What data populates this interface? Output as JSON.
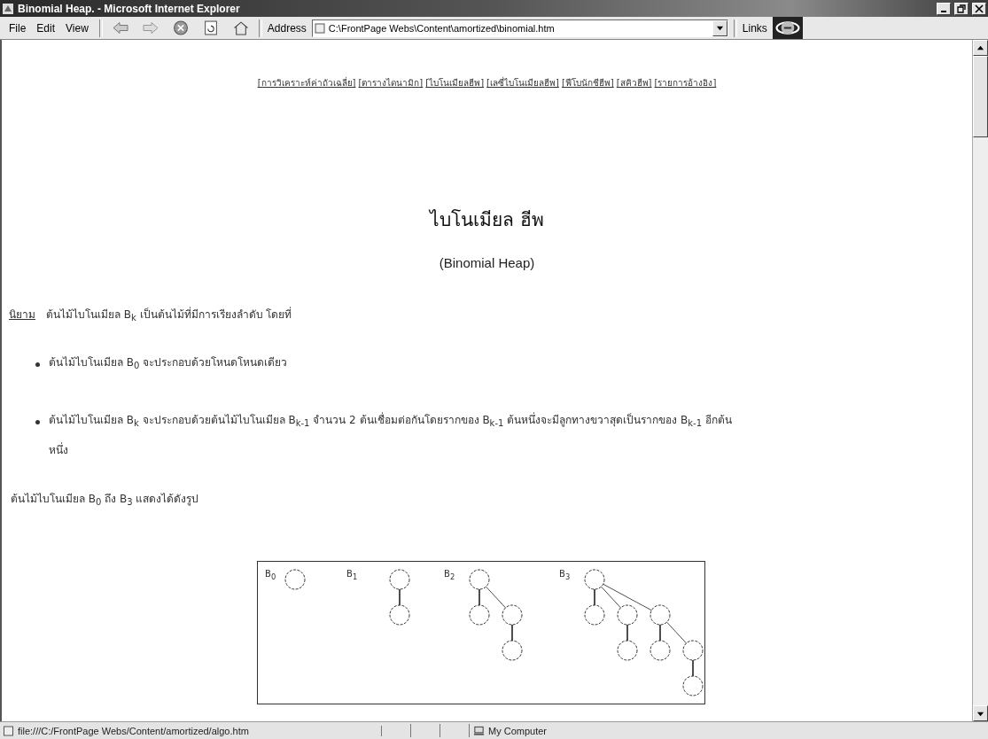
{
  "window": {
    "title": "Binomial Heap. - Microsoft Internet Explorer"
  },
  "menu": [
    "File",
    "Edit",
    "View"
  ],
  "address": {
    "label": "Address",
    "value": "C:\\FrontPage Webs\\Content\\amortized\\binomial.htm"
  },
  "links_label": "Links",
  "nav_links": [
    "[การวิเคราะห์ค่าถัวเฉลี่ย]",
    "[ตารางไดนามิก]",
    "[ไบโนเมียลฮีพ]",
    "[เลซี่ไบโนเมียลฮีพ]",
    "[ฟีโบนักชีฮีพ]",
    "[สคิวฮีพ]",
    "[รายการอ้างอิง]"
  ],
  "heading": "ไบโนเมียล ฮีพ",
  "subheading": "(Binomial Heap)",
  "definition": {
    "term": "นิยาม",
    "text": "ต้นไม้ไบโนเมียล B$_{k}$ เป็นต้นไม้ที่มีการเรียงลำดับ โดยที่"
  },
  "bullets": [
    "ต้นไม้ไบโนเมียล B$_{0}$ จะประกอบด้วยโหนดโหนดเดียว",
    "ต้นไม้ไบโนเมียล B$_{k}$ จะประกอบด้วยต้นไม้ไบโนเมียล B$_{k-1}$ จำนวน 2 ต้นเชื่อมต่อกันโดยรากของ B$_{k-1}$ ต้นหนึ่งจะมีลูกทางขวาสุดเป็นรากของ B$_{k-1}$ อีกต้นหนึ่ง"
  ],
  "caption": "ต้นไม้ไบโนเมียล B$_{0}$ ถึง B$_{3}$ แสดงได้ดังรูป",
  "diagram": {
    "trees": [
      {
        "label": "B$_{0}$"
      },
      {
        "label": "B$_{1}$"
      },
      {
        "label": "B$_{2}$"
      },
      {
        "label": "B$_{3}$"
      }
    ]
  },
  "status_bar": {
    "url": "file:///C:/FrontPage Webs/Content/amortized/algo.htm",
    "zone": "My Computer"
  }
}
